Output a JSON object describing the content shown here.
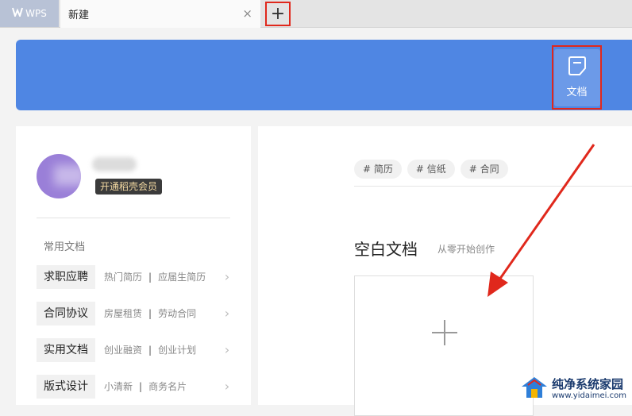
{
  "tabbar": {
    "app_name": "WPS",
    "doc_tab_title": "新建",
    "close_glyph": "×",
    "new_tab_glyph": "+"
  },
  "banner": {
    "doc_button_label": "文档"
  },
  "user": {
    "vip_label": "开通稻壳会员"
  },
  "sidebar": {
    "section_title": "常用文档",
    "categories": [
      {
        "label": "求职应聘",
        "links": [
          "热门简历",
          "应届生简历"
        ]
      },
      {
        "label": "合同协议",
        "links": [
          "房屋租赁",
          "劳动合同"
        ]
      },
      {
        "label": "实用文档",
        "links": [
          "创业融资",
          "创业计划"
        ]
      },
      {
        "label": "版式设计",
        "links": [
          "小清新",
          "商务名片"
        ]
      }
    ],
    "separator": "|",
    "chevron": "›"
  },
  "main": {
    "tags": [
      "# 简历",
      "# 信纸",
      "# 合同"
    ],
    "blank_title": "空白文档",
    "blank_subtitle": "从零开始创作"
  },
  "watermark": {
    "title": "纯净系统家园",
    "url": "www.yidaimei.com"
  },
  "colors": {
    "banner": "#4f86e3",
    "highlight_red": "#e0281c",
    "vip_text": "#f3d9a2"
  }
}
